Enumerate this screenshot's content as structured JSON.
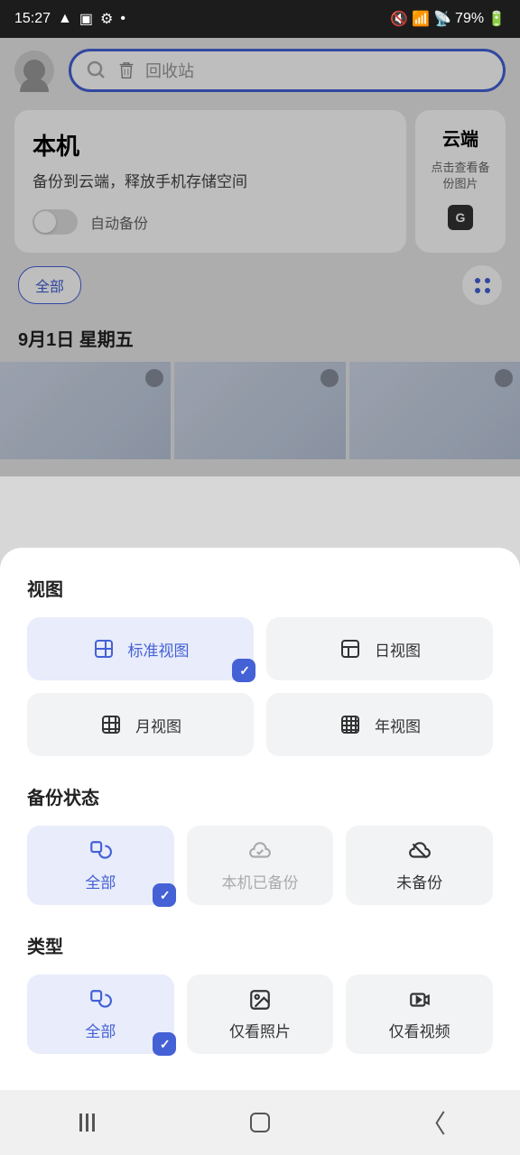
{
  "status": {
    "time": "15:27",
    "battery": "79%"
  },
  "search": {
    "placeholder": "回收站"
  },
  "local_card": {
    "title": "本机",
    "subtitle": "备份到云端，释放手机存储空间",
    "toggle_label": "自动备份"
  },
  "cloud_card": {
    "title": "云端",
    "subtitle": "点击查看备份图片"
  },
  "filter": {
    "all": "全部"
  },
  "date_header": "9月1日 星期五",
  "sheet": {
    "view": {
      "title": "视图",
      "options": [
        "标准视图",
        "日视图",
        "月视图",
        "年视图"
      ],
      "selected": 0
    },
    "backup": {
      "title": "备份状态",
      "options": [
        "全部",
        "本机已备份",
        "未备份"
      ],
      "selected": 0
    },
    "type": {
      "title": "类型",
      "options": [
        "全部",
        "仅看照片",
        "仅看视频"
      ],
      "selected": 0
    }
  }
}
